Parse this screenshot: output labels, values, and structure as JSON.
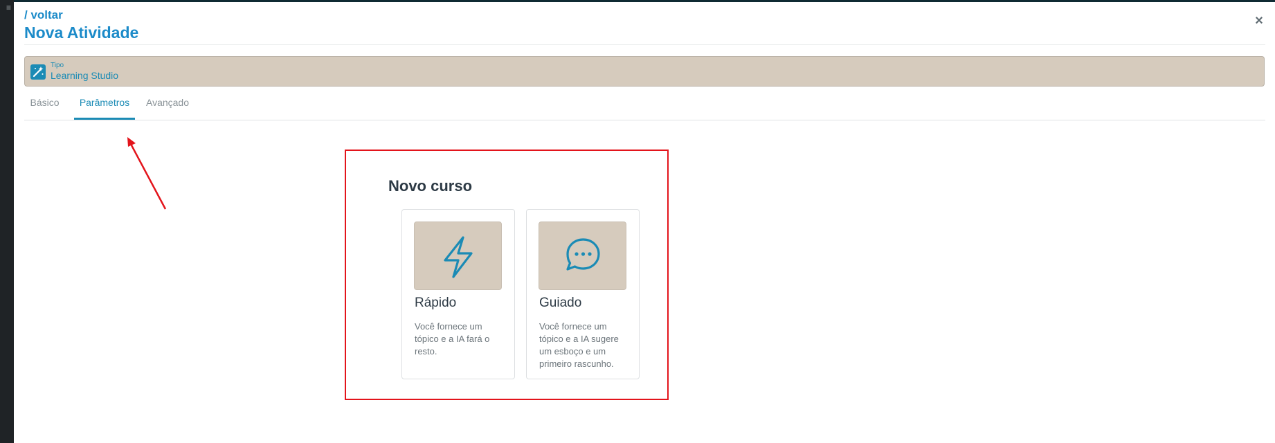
{
  "header": {
    "back_label": "/ voltar",
    "title": "Nova Atividade",
    "close_label": "×"
  },
  "type_bar": {
    "label": "Tipo",
    "value": "Learning Studio",
    "icon": "magic-wand-icon"
  },
  "tabs": [
    {
      "label": "Básico",
      "active": false
    },
    {
      "label": "Parâmetros",
      "active": true
    },
    {
      "label": "Avançado",
      "active": false
    }
  ],
  "new_course": {
    "title": "Novo curso",
    "options": [
      {
        "title": "Rápido",
        "description": "Você fornece um tópico e a IA fará o resto.",
        "icon": "lightning-icon"
      },
      {
        "title": "Guiado",
        "description": "Você fornece um tópico e a IA sugere um esboço e um primeiro rascunho.",
        "icon": "chat-bubble-icon"
      }
    ]
  },
  "colors": {
    "accent": "#1b8bb5",
    "title_blue": "#1c8bc9",
    "beige": "#d6cbbd",
    "highlight_red": "#e3141b"
  }
}
